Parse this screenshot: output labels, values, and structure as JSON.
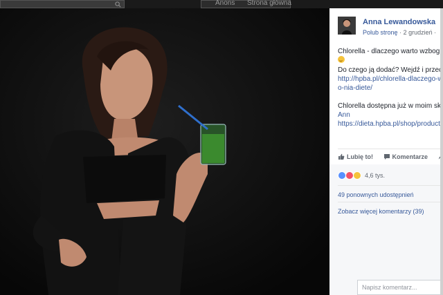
{
  "topbar": {
    "tab_1": "Anons",
    "tab_2": "Strona główna"
  },
  "post": {
    "author": "Anna Lewandowska",
    "like_page": "Polub stronę",
    "separator": "·",
    "date": "2 grudzień",
    "line1": "Chlorella - dlaczego warto wzbog",
    "line2": "Do czego ją dodać? Wejdź i przec",
    "link1_line1": "http://hpba.pl/chlorella-dlaczego-w",
    "link1_line2": "o-nia-diete/",
    "line3": "Chlorella dostępna już w moim sk",
    "line4": "Ann",
    "link2": "https://dieta.hpba.pl/shop/product"
  },
  "actions": {
    "like": "Lubię to!",
    "comment": "Komentarze",
    "share": "U"
  },
  "reactions": {
    "count": "4,6 tys."
  },
  "shares": "49 ponownych udostępnień",
  "more_comments": "Zobacz więcej komentarzy (39)",
  "comment_input": {
    "placeholder": "Napisz komentarz..."
  },
  "colors": {
    "link": "#365899",
    "like": "#5890ff",
    "love": "#f25268",
    "wow": "#f5c33b",
    "panel_bg": "#ffffff",
    "footer_bg": "#f6f7f9"
  }
}
